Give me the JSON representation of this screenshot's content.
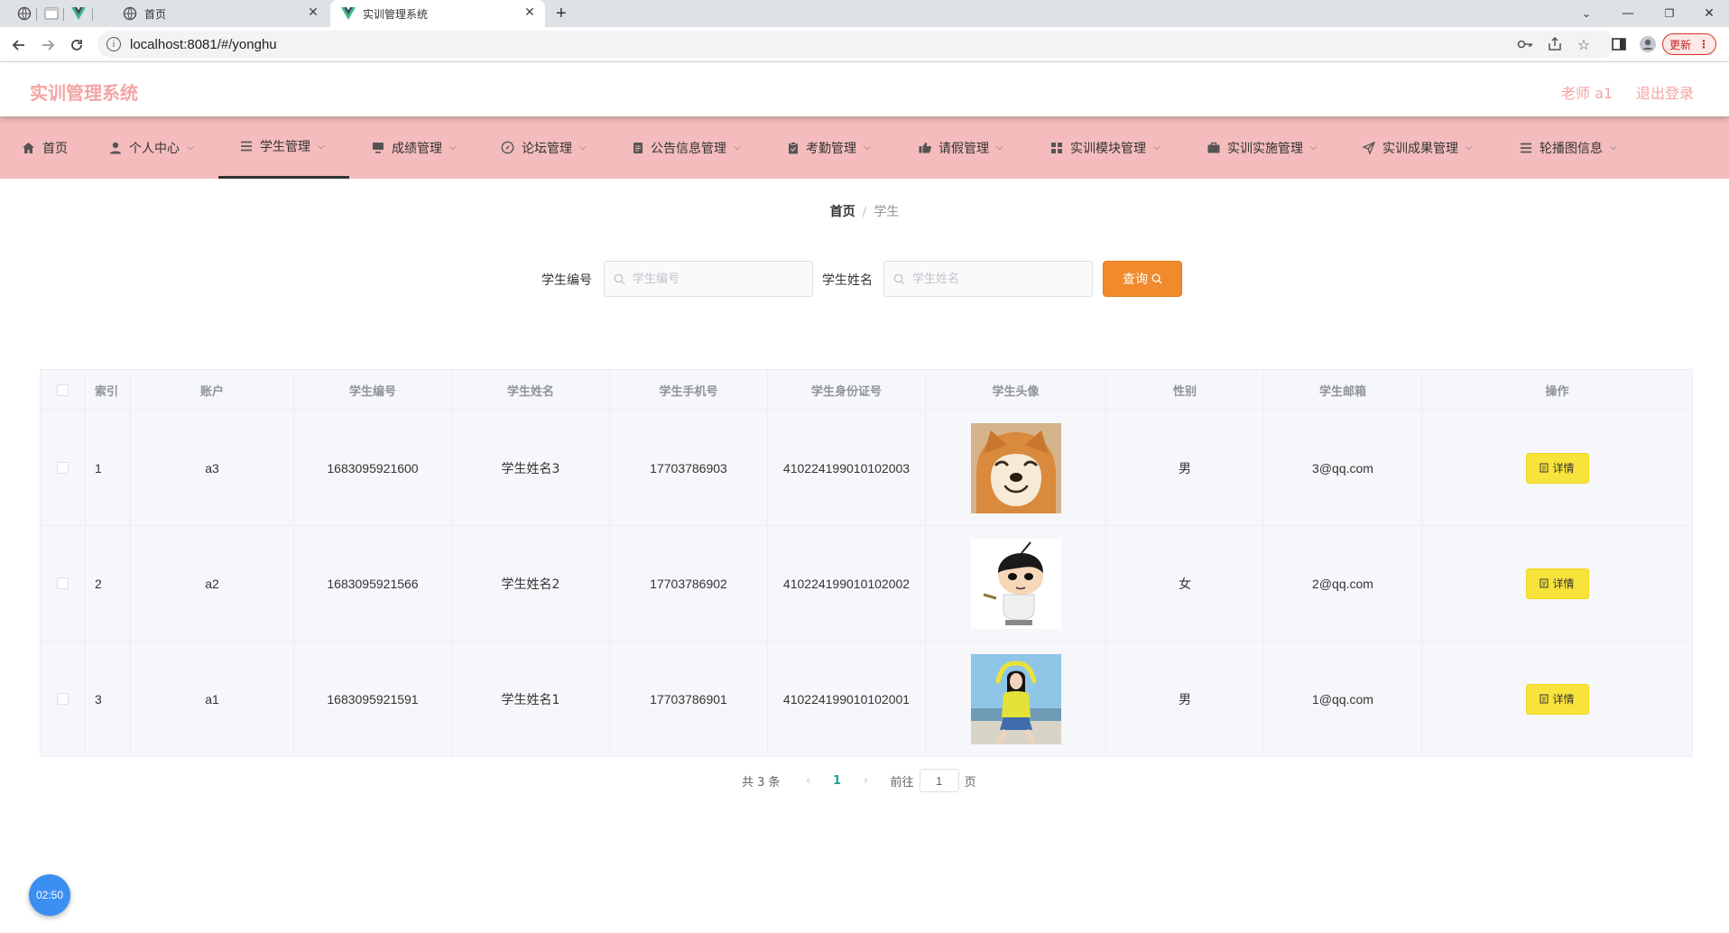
{
  "browser": {
    "tabs": [
      {
        "title": "首页"
      },
      {
        "title": "实训管理系统"
      }
    ],
    "url": "localhost:8081/#/yonghu",
    "update_label": "更新"
  },
  "header": {
    "brand": "实训管理系统",
    "user": "老师 a1",
    "logout": "退出登录"
  },
  "menu": {
    "items": [
      {
        "label": "首页",
        "icon": "home-icon"
      },
      {
        "label": "个人中心",
        "icon": "user-icon"
      },
      {
        "label": "学生管理",
        "icon": "list-icon"
      },
      {
        "label": "成绩管理",
        "icon": "monitor-icon"
      },
      {
        "label": "论坛管理",
        "icon": "compass-icon"
      },
      {
        "label": "公告信息管理",
        "icon": "document-icon"
      },
      {
        "label": "考勤管理",
        "icon": "clipboard-icon"
      },
      {
        "label": "请假管理",
        "icon": "thumb-icon"
      },
      {
        "label": "实训模块管理",
        "icon": "grid-icon"
      },
      {
        "label": "实训实施管理",
        "icon": "briefcase-icon"
      },
      {
        "label": "实训成果管理",
        "icon": "send-icon"
      },
      {
        "label": "轮播图信息",
        "icon": "menu-icon"
      }
    ]
  },
  "breadcrumb": {
    "home": "首页",
    "sep": "/",
    "current": "学生"
  },
  "search": {
    "student_no_label": "学生编号",
    "student_no_placeholder": "学生编号",
    "student_name_label": "学生姓名",
    "student_name_placeholder": "学生姓名",
    "query_label": "查询"
  },
  "table": {
    "headers": [
      "索引",
      "账户",
      "学生编号",
      "学生姓名",
      "学生手机号",
      "学生身份证号",
      "学生头像",
      "性别",
      "学生邮箱",
      "操作"
    ],
    "rows": [
      {
        "index": "1",
        "account": "a3",
        "student_no": "1683095921600",
        "name": "学生姓名3",
        "phone": "17703786903",
        "id_card": "410224199010102003",
        "avatar": "shiba-dog-avatar",
        "gender": "男",
        "email": "3@qq.com"
      },
      {
        "index": "2",
        "account": "a2",
        "student_no": "1683095921566",
        "name": "学生姓名2",
        "phone": "17703786902",
        "id_card": "410224199010102002",
        "avatar": "cartoon-boy-avatar",
        "gender": "女",
        "email": "2@qq.com"
      },
      {
        "index": "3",
        "account": "a1",
        "student_no": "1683095921591",
        "name": "学生姓名1",
        "phone": "17703786901",
        "id_card": "410224199010102001",
        "avatar": "girl-beach-avatar",
        "gender": "男",
        "email": "1@qq.com"
      }
    ],
    "detail_label": "详情"
  },
  "pagination": {
    "total": "共 3 条",
    "current": "1",
    "goto_label": "前往",
    "goto_value": "1",
    "page_unit": "页"
  },
  "timer": "02:50"
}
